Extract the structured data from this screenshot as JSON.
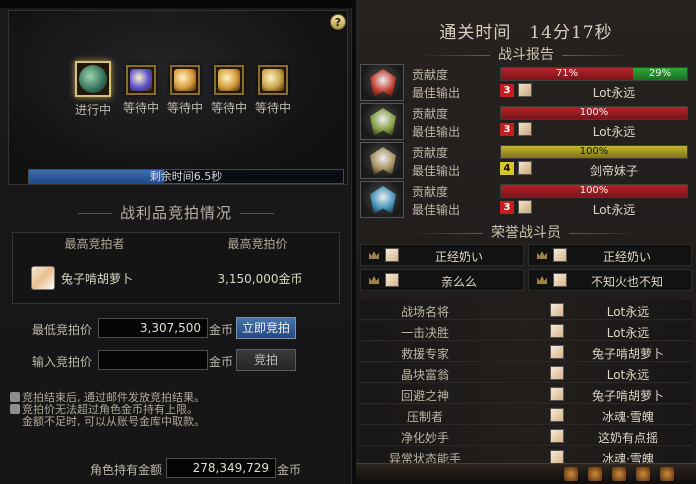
{
  "left": {
    "help_label": "?",
    "slots": [
      {
        "label": "进行中",
        "status": "active",
        "color": "#3f8f6a"
      },
      {
        "label": "等待中",
        "status": "waiting",
        "color": "#5a4fd0"
      },
      {
        "label": "等待中",
        "status": "waiting",
        "color": "#d59a3a"
      },
      {
        "label": "等待中",
        "status": "waiting",
        "color": "#d59a3a"
      },
      {
        "label": "等待中",
        "status": "waiting",
        "color": "#c9a14a"
      }
    ],
    "timer": {
      "text": "剩余时间6.5秒",
      "fraction": 0.43
    },
    "bid_title": "战利品竞拍情况",
    "table": {
      "col_bidder": "最高竞拍者",
      "col_price": "最高竞拍价",
      "bidder_name": "兔子啃胡萝卜",
      "price": "3,150,000金币"
    },
    "min_bid": {
      "label": "最低竞拍价",
      "value": "3,307,500",
      "unit": "金币",
      "button": "立即竞拍"
    },
    "input_bid": {
      "label": "输入竞拍价",
      "value": "",
      "unit": "金币",
      "button": "竞拍"
    },
    "notes": [
      "竞拍结束后, 通过邮件发放竞拍结果。",
      "竞拍价无法超过角色金币持有上限。",
      "金额不足时, 可以从账号金库中取款。"
    ],
    "gold": {
      "label": "角色持有金额",
      "value": "278,349,729",
      "unit": "金币"
    }
  },
  "right": {
    "clear_time": "通关时间　14分17秒",
    "battle_report_title": "战斗报告",
    "row_label_contrib": "贡献度",
    "row_label_best": "最佳输出",
    "players": [
      {
        "mask_color": "#c0392b",
        "bar": [
          {
            "pct": 71,
            "label": "71%",
            "color": "red"
          },
          {
            "pct": 29,
            "label": "29%",
            "color": "green"
          }
        ],
        "badge": "3",
        "badge_color": "red",
        "best": "Lot永远"
      },
      {
        "mask_color": "#7f9a3a",
        "bar": [
          {
            "pct": 100,
            "label": "100%",
            "color": "red"
          }
        ],
        "badge": "3",
        "badge_color": "red",
        "best": "Lot永远"
      },
      {
        "mask_color": "#a08d5a",
        "bar": [
          {
            "pct": 100,
            "label": "100%",
            "color": "yellow"
          }
        ],
        "badge": "4",
        "badge_color": "yellow",
        "best": "剑帝妹子"
      },
      {
        "mask_color": "#3f8fb8",
        "bar": [
          {
            "pct": 100,
            "label": "100%",
            "color": "red"
          }
        ],
        "badge": "3",
        "badge_color": "red",
        "best": "Lot永远"
      }
    ],
    "honor_title": "荣誉战斗员",
    "honor": [
      "正经奶い",
      "正经奶い",
      "亲么么",
      "不知火也不知"
    ],
    "awards": [
      {
        "title": "战场名将",
        "name": "Lot永远"
      },
      {
        "title": "一击决胜",
        "name": "Lot永远"
      },
      {
        "title": "救援专家",
        "name": "兔子啃胡萝卜"
      },
      {
        "title": "晶块富翁",
        "name": "Lot永远"
      },
      {
        "title": "回避之神",
        "name": "兔子啃胡萝卜"
      },
      {
        "title": "压制者",
        "name": "冰魂·雪魄"
      },
      {
        "title": "净化妙手",
        "name": "这奶有点摇"
      },
      {
        "title": "异常状态能手",
        "name": "冰魂·雪魄"
      }
    ]
  }
}
